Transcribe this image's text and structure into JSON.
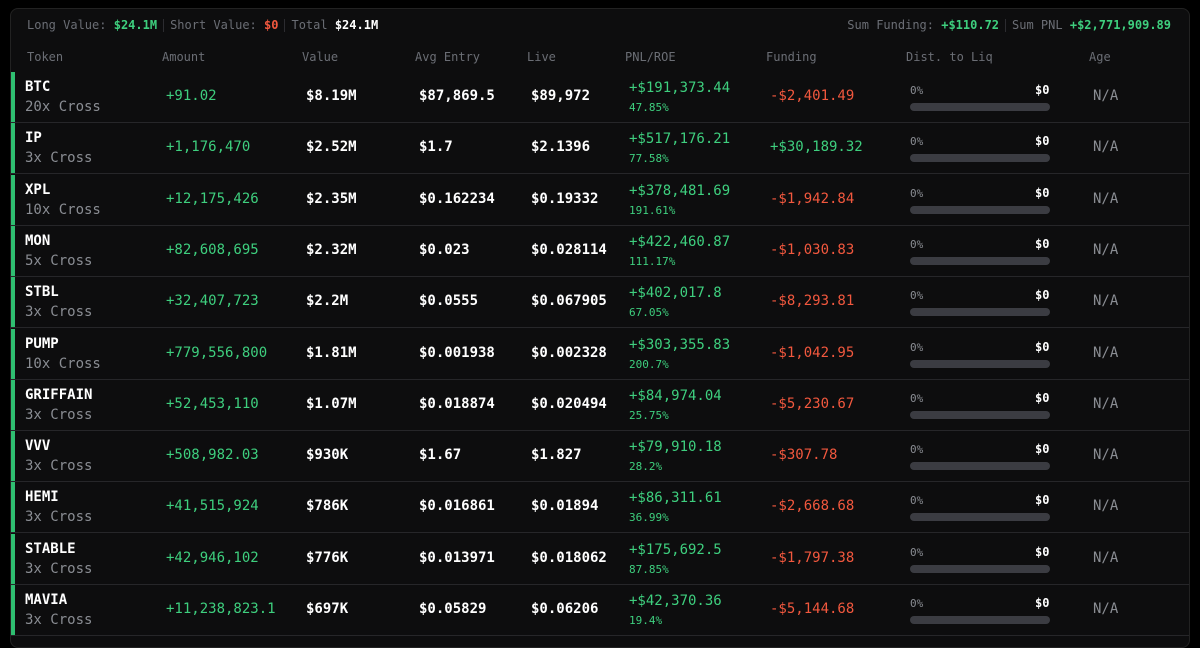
{
  "summary": {
    "long_label": "Long Value:",
    "long_value": "$24.1M",
    "short_label": "Short Value:",
    "short_value": "$0",
    "total_label": "Total",
    "total_value": "$24.1M",
    "funding_label": "Sum Funding:",
    "funding_value": "+$110.72",
    "pnl_label": "Sum PNL",
    "pnl_value": "+$2,771,909.89"
  },
  "columns": [
    "Token",
    "Amount",
    "Value",
    "Avg Entry",
    "Live",
    "PNL/ROE",
    "Funding",
    "Dist. to Liq",
    "Age"
  ],
  "rows": [
    {
      "token": "BTC",
      "leverage": "20x Cross",
      "amount": "+91.02",
      "value": "$8.19M",
      "avg_entry": "$87,869.5",
      "live": "$89,972",
      "pnl": "+$191,373.44",
      "roe": "47.85%",
      "funding": "-$2,401.49",
      "dist_pct": "0%",
      "dist_value": "$0",
      "dist_fraction": 0,
      "age": "N/A"
    },
    {
      "token": "IP",
      "leverage": "3x Cross",
      "amount": "+1,176,470",
      "value": "$2.52M",
      "avg_entry": "$1.7",
      "live": "$2.1396",
      "pnl": "+$517,176.21",
      "roe": "77.58%",
      "funding": "+$30,189.32",
      "dist_pct": "0%",
      "dist_value": "$0",
      "dist_fraction": 0,
      "age": "N/A"
    },
    {
      "token": "XPL",
      "leverage": "10x Cross",
      "amount": "+12,175,426",
      "value": "$2.35M",
      "avg_entry": "$0.162234",
      "live": "$0.19332",
      "pnl": "+$378,481.69",
      "roe": "191.61%",
      "funding": "-$1,942.84",
      "dist_pct": "0%",
      "dist_value": "$0",
      "dist_fraction": 0,
      "age": "N/A"
    },
    {
      "token": "MON",
      "leverage": "5x Cross",
      "amount": "+82,608,695",
      "value": "$2.32M",
      "avg_entry": "$0.023",
      "live": "$0.028114",
      "pnl": "+$422,460.87",
      "roe": "111.17%",
      "funding": "-$1,030.83",
      "dist_pct": "0%",
      "dist_value": "$0",
      "dist_fraction": 0,
      "age": "N/A"
    },
    {
      "token": "STBL",
      "leverage": "3x Cross",
      "amount": "+32,407,723",
      "value": "$2.2M",
      "avg_entry": "$0.0555",
      "live": "$0.067905",
      "pnl": "+$402,017.8",
      "roe": "67.05%",
      "funding": "-$8,293.81",
      "dist_pct": "0%",
      "dist_value": "$0",
      "dist_fraction": 0,
      "age": "N/A"
    },
    {
      "token": "PUMP",
      "leverage": "10x Cross",
      "amount": "+779,556,800",
      "value": "$1.81M",
      "avg_entry": "$0.001938",
      "live": "$0.002328",
      "pnl": "+$303,355.83",
      "roe": "200.7%",
      "funding": "-$1,042.95",
      "dist_pct": "0%",
      "dist_value": "$0",
      "dist_fraction": 0,
      "age": "N/A"
    },
    {
      "token": "GRIFFAIN",
      "leverage": "3x Cross",
      "amount": "+52,453,110",
      "value": "$1.07M",
      "avg_entry": "$0.018874",
      "live": "$0.020494",
      "pnl": "+$84,974.04",
      "roe": "25.75%",
      "funding": "-$5,230.67",
      "dist_pct": "0%",
      "dist_value": "$0",
      "dist_fraction": 0,
      "age": "N/A"
    },
    {
      "token": "VVV",
      "leverage": "3x Cross",
      "amount": "+508,982.03",
      "value": "$930K",
      "avg_entry": "$1.67",
      "live": "$1.827",
      "pnl": "+$79,910.18",
      "roe": "28.2%",
      "funding": "-$307.78",
      "dist_pct": "0%",
      "dist_value": "$0",
      "dist_fraction": 0,
      "age": "N/A"
    },
    {
      "token": "HEMI",
      "leverage": "3x Cross",
      "amount": "+41,515,924",
      "value": "$786K",
      "avg_entry": "$0.016861",
      "live": "$0.01894",
      "pnl": "+$86,311.61",
      "roe": "36.99%",
      "funding": "-$2,668.68",
      "dist_pct": "0%",
      "dist_value": "$0",
      "dist_fraction": 0,
      "age": "N/A"
    },
    {
      "token": "STABLE",
      "leverage": "3x Cross",
      "amount": "+42,946,102",
      "value": "$776K",
      "avg_entry": "$0.013971",
      "live": "$0.018062",
      "pnl": "+$175,692.5",
      "roe": "87.85%",
      "funding": "-$1,797.38",
      "dist_pct": "0%",
      "dist_value": "$0",
      "dist_fraction": 0,
      "age": "N/A"
    },
    {
      "token": "MAVIA",
      "leverage": "3x Cross",
      "amount": "+11,238,823.1",
      "value": "$697K",
      "avg_entry": "$0.05829",
      "live": "$0.06206",
      "pnl": "+$42,370.36",
      "roe": "19.4%",
      "funding": "-$5,144.68",
      "dist_pct": "0%",
      "dist_value": "$0",
      "dist_fraction": 0,
      "age": "N/A"
    }
  ]
}
